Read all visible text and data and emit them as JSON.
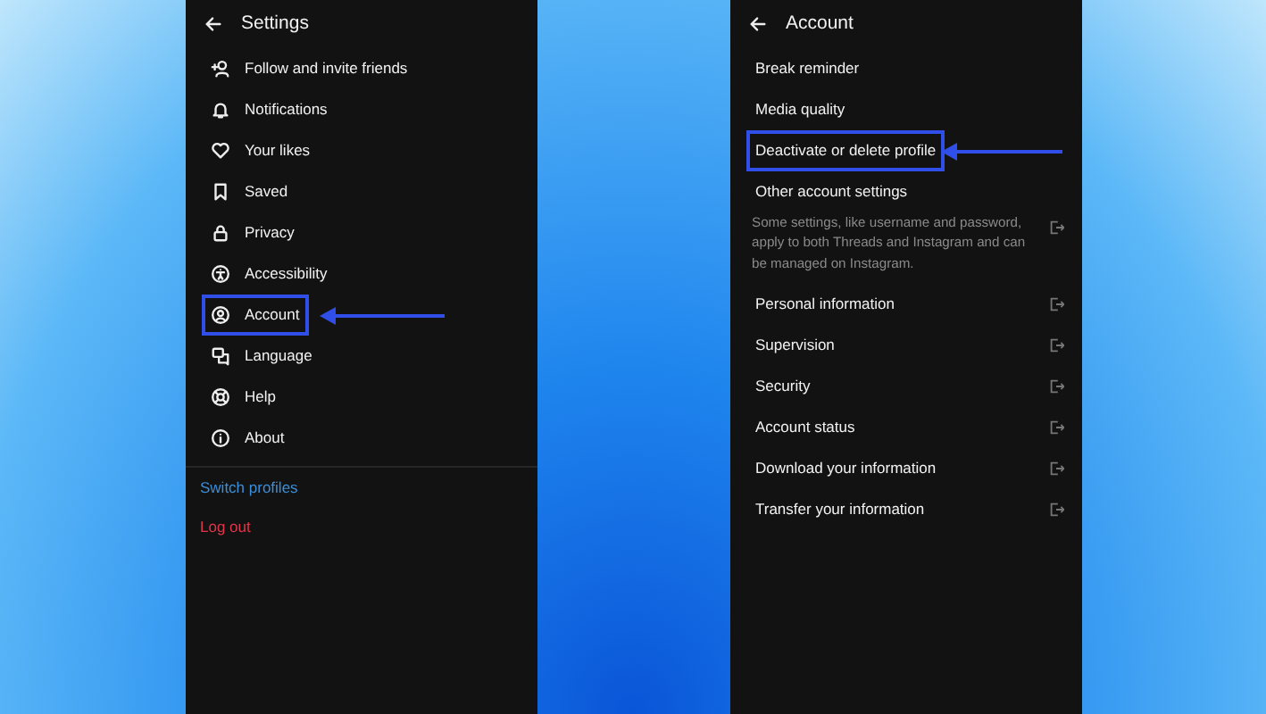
{
  "settings": {
    "title": "Settings",
    "items": [
      {
        "label": "Follow and invite friends",
        "highlighted": false
      },
      {
        "label": "Notifications",
        "highlighted": false
      },
      {
        "label": "Your likes",
        "highlighted": false
      },
      {
        "label": "Saved",
        "highlighted": false
      },
      {
        "label": "Privacy",
        "highlighted": false
      },
      {
        "label": "Accessibility",
        "highlighted": false
      },
      {
        "label": "Account",
        "highlighted": true
      },
      {
        "label": "Language",
        "highlighted": false
      },
      {
        "label": "Help",
        "highlighted": false
      },
      {
        "label": "About",
        "highlighted": false
      }
    ],
    "links": [
      {
        "label": "Switch profiles",
        "color": "#3b8fd9"
      },
      {
        "label": "Log out",
        "color": "#e0364a"
      }
    ]
  },
  "account": {
    "title": "Account",
    "items": [
      {
        "label": "Break reminder",
        "highlighted": false,
        "external": false
      },
      {
        "label": "Media quality",
        "highlighted": false,
        "external": false
      },
      {
        "label": "Deactivate or delete profile",
        "highlighted": true,
        "external": false
      },
      {
        "label": "Other account settings",
        "description": "Some settings, like username and password, apply to both Threads and Instagram and can be managed on Instagram.",
        "highlighted": false,
        "external": true
      },
      {
        "label": "Personal information",
        "highlighted": false,
        "external": true
      },
      {
        "label": "Supervision",
        "highlighted": false,
        "external": true
      },
      {
        "label": "Security",
        "highlighted": false,
        "external": true
      },
      {
        "label": "Account status",
        "highlighted": false,
        "external": true
      },
      {
        "label": "Download your information",
        "highlighted": false,
        "external": true
      },
      {
        "label": "Transfer your information",
        "highlighted": false,
        "external": true
      }
    ]
  }
}
